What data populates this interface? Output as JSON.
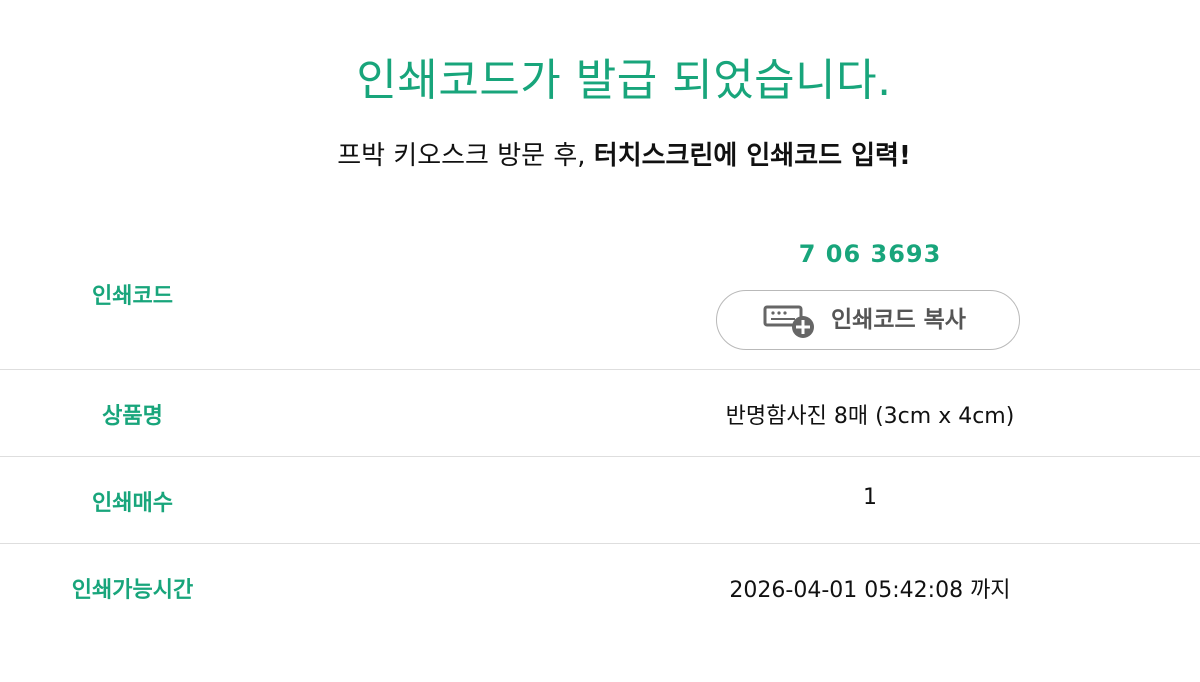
{
  "header": {
    "title": "인쇄코드가 발급 되었습니다.",
    "subtitle_normal": "프박 키오스크 방문 후, ",
    "subtitle_bold": "터치스크린에 인쇄코드 입력!"
  },
  "table": {
    "code": {
      "label": "인쇄코드",
      "value": "7 06 3693",
      "copy_label": "인쇄코드 복사",
      "copy_icon": "code-copy-icon"
    },
    "product": {
      "label": "상품명",
      "value": "반명함사진 8매 (3cm x 4cm)"
    },
    "count": {
      "label": "인쇄매수",
      "value": "1"
    },
    "expiry": {
      "label": "인쇄가능시간",
      "value": "2026-04-01 05:42:08 까지"
    }
  },
  "colors": {
    "accent": "#18a57b",
    "text": "#111111",
    "button_text": "#555555",
    "divider": "#dedede"
  }
}
